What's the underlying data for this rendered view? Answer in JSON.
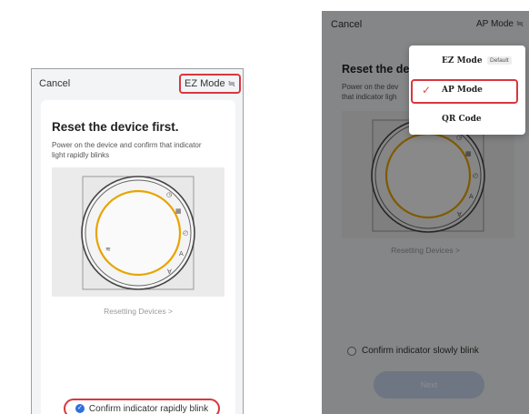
{
  "left": {
    "cancel_label": "Cancel",
    "mode_label": "EZ Mode",
    "mode_icon": "≒",
    "title": "Reset the device first.",
    "description": "Power on the device and confirm that indicator light rapidly blinks",
    "reset_link": "Resetting Devices >",
    "confirm_label": "Confirm indicator rapidly blink"
  },
  "right": {
    "cancel_label": "Cancel",
    "mode_label": "AP Mode",
    "mode_icon": "≒",
    "title": "Reset the de",
    "description": "Power on the dev\nthat indicator ligh",
    "reset_link": "Resetting Devices >",
    "confirm_label": "Confirm indicator slowly blink",
    "next_label": "Next",
    "menu": {
      "items": [
        {
          "label": "EZ Mode",
          "badge": "Default"
        },
        {
          "label": "AP Mode",
          "selected": true
        },
        {
          "label": "QR Code"
        }
      ]
    }
  },
  "colors": {
    "highlight": "#d9373f",
    "accent_blue": "#2f6fe0",
    "dial_ring": "#e8a400"
  },
  "thermostat_icons": [
    "clock-icon",
    "mode-icon",
    "power-icon",
    "up-icon",
    "down-icon",
    "wifi-icon"
  ]
}
